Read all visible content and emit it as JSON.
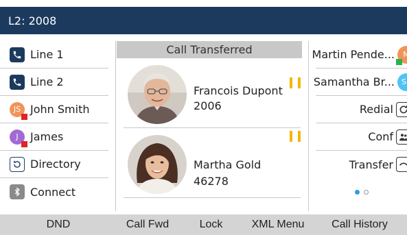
{
  "status_bar": {
    "title": "L2: 2008"
  },
  "left_keys": [
    {
      "label": "Line 1",
      "icon": "phone-icon"
    },
    {
      "label": "Line 2",
      "icon": "phone-icon"
    },
    {
      "label": "John Smith",
      "avatar_text": "JS",
      "avatar_color": "#f0955a",
      "presence_color": "#e02424"
    },
    {
      "label": "James",
      "avatar_text": "J",
      "avatar_color": "#a36ad6",
      "presence_color": "#e02424"
    },
    {
      "label": "Directory",
      "icon": "directory-icon"
    },
    {
      "label": "Connect",
      "icon": "bluetooth-icon"
    }
  ],
  "center": {
    "header": "Call Transferred",
    "calls": [
      {
        "name": "Francois Dupont",
        "number": "2006",
        "state": "hold"
      },
      {
        "name": "Martha Gold",
        "number": "46278",
        "state": "hold"
      }
    ]
  },
  "right_keys": [
    {
      "label": "Martin Pende...",
      "avatar_text": "M",
      "avatar_color": "#f0955a",
      "presence_color": "#2bb24c"
    },
    {
      "label": "Samantha Br...",
      "avatar_text": "SE",
      "avatar_color": "#4fc3f7"
    },
    {
      "label": "Redial",
      "icon": "redial-icon"
    },
    {
      "label": "Conf",
      "icon": "conference-icon"
    },
    {
      "label": "Transfer",
      "icon": "transfer-icon"
    }
  ],
  "pagination": {
    "current": 1,
    "total": 2
  },
  "softkeys": [
    "DND",
    "Call Fwd",
    "Lock",
    "XML Menu",
    "Call History"
  ],
  "colors": {
    "brand": "#1c3a5e",
    "hold": "#f2b800",
    "accent": "#2a9ee0"
  }
}
